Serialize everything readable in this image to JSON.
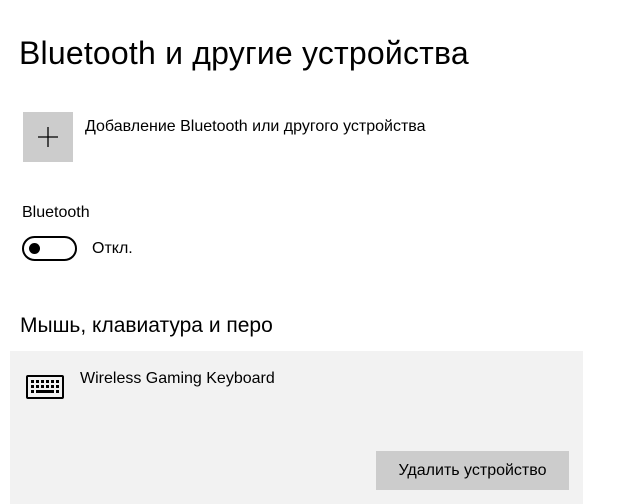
{
  "page": {
    "title": "Bluetooth и другие устройства"
  },
  "add_device": {
    "icon": "plus-icon",
    "label": "Добавление Bluetooth или другого устройства"
  },
  "bluetooth": {
    "label": "Bluetooth",
    "toggle_on": false,
    "state_text": "Откл."
  },
  "mouse_section": {
    "title": "Мышь, клавиатура и перо",
    "devices": [
      {
        "icon": "keyboard-icon",
        "name": "Wireless Gaming Keyboard",
        "remove_label": "Удалить устройство"
      }
    ]
  },
  "colors": {
    "tile_gray": "#cccccc",
    "card_background": "#f2f2f2",
    "text": "#000000"
  }
}
